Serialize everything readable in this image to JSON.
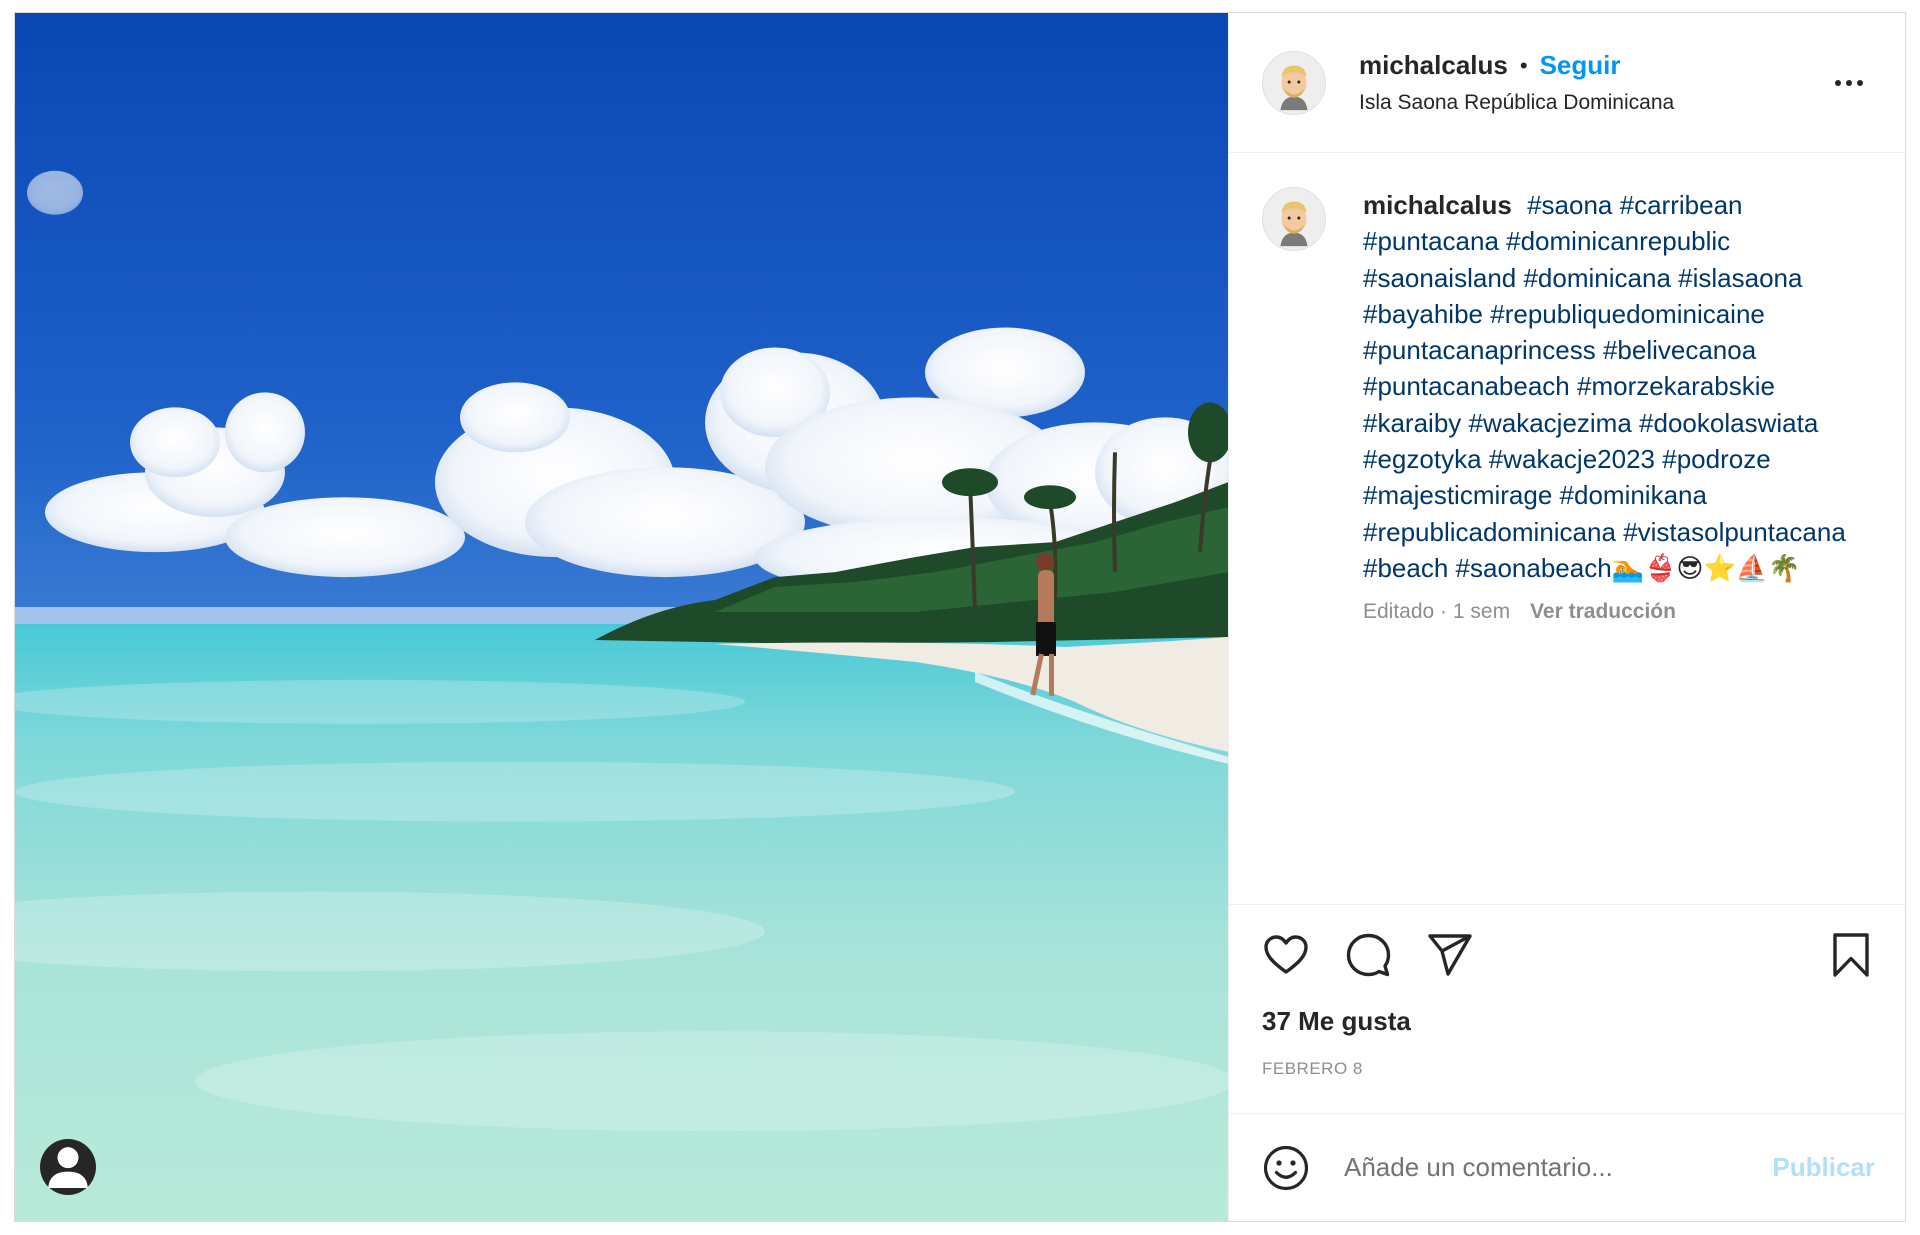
{
  "header": {
    "username": "michalcalus",
    "separator": "•",
    "follow_label": "Seguir",
    "location": "Isla Saona República Dominicana",
    "more_icon": "more-horizontal-icon"
  },
  "caption": {
    "username": "michalcalus",
    "hashtags": [
      "#saona",
      "#carribean",
      "#puntacana",
      "#dominicanrepublic",
      "#saonaisland",
      "#dominicana",
      "#islasaona",
      "#bayahibe",
      "#republiquedominicaine",
      "#puntacanaprincess",
      "#belivecanoa",
      "#puntacanabeach",
      "#morzekarabskie",
      "#karaiby",
      "#wakacjezima",
      "#dookolaswiata",
      "#egzotyka",
      "#wakacje2023",
      "#podroze",
      "#majesticmirage",
      "#dominikana",
      "#republicadominicana",
      "#vistasolpuntacana",
      "#beach",
      "#saonabeach"
    ],
    "emojis": "🏊👙😎⭐⛵🌴",
    "edited": "Editado · 1 sem",
    "translation_label": "Ver traducción"
  },
  "actions": {
    "like_icon": "heart-icon",
    "comment_icon": "comment-icon",
    "share_icon": "paper-plane-icon",
    "save_icon": "bookmark-icon"
  },
  "likes_text": "37 Me gusta",
  "date_text": "FEBRERO 8",
  "comment": {
    "emoji_icon": "smiley-icon",
    "placeholder": "Añade un comentario...",
    "post_label": "Publicar"
  },
  "colors": {
    "link_blue": "#0095f6",
    "hashtag_navy": "#00376b",
    "muted_gray": "#8e8e8e",
    "disabled_blue": "#b2dffc"
  }
}
